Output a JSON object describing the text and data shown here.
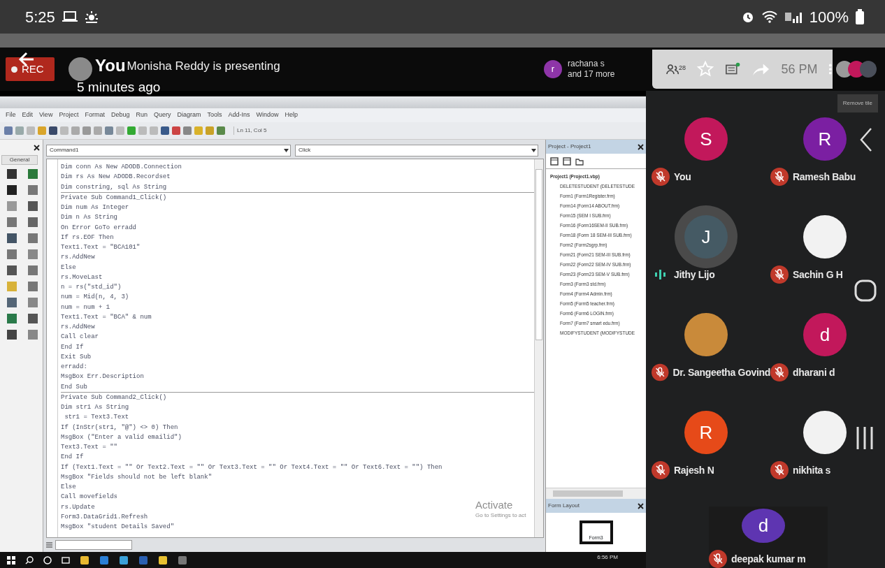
{
  "status_bar": {
    "time": "5:25",
    "battery": "100%"
  },
  "meeting_header": {
    "rec": "REC",
    "overlay_name": "You",
    "presenting": "Monisha Reddy is presenting",
    "time_ago": "5 minutes ago",
    "others": {
      "initial": "r",
      "color": "#8e35a8",
      "name": "rachana s",
      "more": "and 17 more"
    },
    "participant_count": "28",
    "clock": "56 PM"
  },
  "shared_screen": {
    "menu": [
      "File",
      "Edit",
      "View",
      "Project",
      "Format",
      "Debug",
      "Run",
      "Query",
      "Diagram",
      "Tools",
      "Add-Ins",
      "Window",
      "Help"
    ],
    "position": "Ln 11, Col 5",
    "toolbox_tab": "General",
    "object_combo": "Command1",
    "event_combo": "Click",
    "procedures": [
      {
        "lines": [
          "Dim conn As New ADODB.Connection",
          "Dim rs As New ADODB.Recordset",
          "Dim constring, sql As String"
        ]
      },
      {
        "lines": [
          "Private Sub Command1_Click()",
          "Dim num As Integer",
          "Dim n As String",
          "On Error GoTo erradd",
          "If rs.EOF Then",
          "Text1.Text = \"BCA101\"",
          "rs.AddNew",
          "Else",
          "rs.MoveLast",
          "n = rs(\"std_id\")",
          "num = Mid(n, 4, 3)",
          "num = num + 1",
          "Text1.Text = \"BCA\" & num",
          "rs.AddNew",
          "Call clear",
          "End If",
          "Exit Sub",
          "erradd:",
          "MsgBox Err.Description",
          "End Sub"
        ]
      },
      {
        "lines": [
          "Private Sub Command2_Click()",
          "Dim str1 As String",
          " str1 = Text3.Text",
          "If (InStr(str1, \"@\") <> 0) Then",
          "MsgBox (\"Enter a valid emailid\")",
          "Text3.Text = \"\"",
          "End If",
          "If (Text1.Text = \"\" Or Text2.Text = \"\" Or Text3.Text = \"\" Or Text4.Text = \"\" Or Text6.Text = \"\") Then",
          "MsgBox \"Fields should not be left blank\"",
          "Else",
          "Call movefields",
          "rs.Update",
          "Form3.DataGrid1.Refresh",
          "MsgBox \"student Details Saved\""
        ]
      }
    ],
    "project_panel": {
      "title": "Project - Project1",
      "root": "Project1 (Project1.vbp)",
      "children": [
        "DELETESTUDENT (DELETESTUDE",
        "Form1 (Form1Register.frm)",
        "Form14 (Form14 ABOUT.frm)",
        "Form15 (SEM I SUB.frm)",
        "Form16 (Form16SEM-II SUB.frm)",
        "Form18 (Form 18 SEM-III SUB.frm)",
        "Form2 (Form2sgrp.frm)",
        "Form21 (Form21 SEM-III SUB.frm)",
        "Form22 (Form22 SEM-IV SUB.frm)",
        "Form23 (Form23 SEM-V SUB.frm)",
        "Form3 (Form3 std.frm)",
        "Form4 (Form4 Admin.frm)",
        "Form5 (Form5 teacher.frm)",
        "Form6 (Form6 LOGIN.frm)",
        "Form7 (Form7 smart edu.frm)",
        "MODIFYSTUDENT (MODIFYSTUDE"
      ]
    },
    "form_layout_title": "Form Layout",
    "form_layout_form": "Form3",
    "watermark": [
      "Activate",
      "Go to Settings to act"
    ],
    "taskbar_time": "6:56 PM"
  },
  "participants_panel": {
    "remove_tile": "Remove tile",
    "participants": [
      {
        "name": "You",
        "initial": "S",
        "kind": "initial",
        "color": "#c2185b",
        "muted": true
      },
      {
        "name": "Ramesh Babu",
        "initial": "R",
        "kind": "initial",
        "color": "#7b1fa2",
        "muted": true
      },
      {
        "name": "Jithy Lijo",
        "initial": "J",
        "kind": "initial",
        "color": "#455a64",
        "muted": false
      },
      {
        "name": "Sachin G H",
        "kind": "image",
        "muted": true
      },
      {
        "name": "Dr. Sangeetha Govind",
        "kind": "photo",
        "muted": true
      },
      {
        "name": "dharani d",
        "initial": "d",
        "kind": "initial",
        "color": "#c2185b",
        "muted": true
      },
      {
        "name": "Rajesh N",
        "initial": "R",
        "kind": "initial",
        "color": "#e64a19",
        "muted": true
      },
      {
        "name": "nikhita s",
        "kind": "image",
        "muted": true
      },
      {
        "name": "deepak kumar m",
        "initial": "d",
        "kind": "initial",
        "color": "#5e35b1",
        "muted": true
      }
    ]
  }
}
